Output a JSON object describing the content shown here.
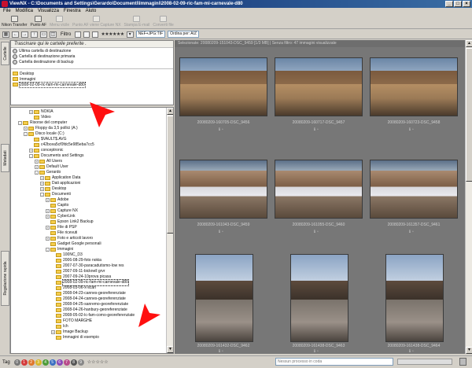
{
  "window": {
    "title": "ViewNX - C:\\Documents and Settings\\Gerardo\\Documenti\\Immagini\\2008-02-09-ric-fam-mi-carnevale-d80"
  },
  "menu": [
    "File",
    "Modifica",
    "Visualizza",
    "Finestra",
    "Aiuto"
  ],
  "toolbar1": [
    {
      "label": "Nikon Transfer",
      "enabled": true
    },
    {
      "label": "Punto AF",
      "enabled": true
    },
    {
      "label": "Menu vicile",
      "enabled": false
    },
    {
      "label": "Punto AF viene Capture NX",
      "enabled": false
    },
    {
      "label": "Stampa E-mail",
      "enabled": false
    },
    {
      "label": "Converti file",
      "enabled": false
    }
  ],
  "toolbar2": {
    "filter_label": "Filtro",
    "stars": "★★★★★★",
    "format_select": "NEF+JPG:TIF",
    "sort_select": "Ordina per: A/Z"
  },
  "sidebar_tabs": {
    "cartelle": "Cartelle",
    "metadati": "Metadati",
    "regolazione": "Regolazione rapida"
  },
  "favorites": {
    "header": "Trascinare qui le cartelle preferite .",
    "shortcuts": [
      "Ultima cartella di destinazione",
      "Cartella di destinazione primaria",
      "Cartella destinazione di backup"
    ],
    "folders": [
      "Desktop",
      "Immagini",
      "2008-02-09-ric-fam-mi-carnevale-d80"
    ]
  },
  "tree": [
    {
      "label": "NOKIA",
      "level": 3,
      "exp": "+"
    },
    {
      "label": "Video",
      "level": 3,
      "exp": ""
    },
    {
      "label": "Risorse del computer",
      "level": 1,
      "exp": "-"
    },
    {
      "label": "Floppy da 3,5 pollici (A:)",
      "level": 2,
      "exp": "+"
    },
    {
      "label": "Disco locale (C:)",
      "level": 2,
      "exp": "-"
    },
    {
      "label": "$VAULT$.AVG",
      "level": 3,
      "exp": ""
    },
    {
      "label": "c42bcea5cf0fdc5e985eba7cc5",
      "level": 3,
      "exp": ""
    },
    {
      "label": "conceptronic",
      "level": 3,
      "exp": "+"
    },
    {
      "label": "Documents and Settings",
      "level": 3,
      "exp": "-"
    },
    {
      "label": "All Users",
      "level": 4,
      "exp": "+"
    },
    {
      "label": "Default User",
      "level": 4,
      "exp": "+"
    },
    {
      "label": "Gerardo",
      "level": 4,
      "exp": "-"
    },
    {
      "label": "Application Data",
      "level": 5,
      "exp": "+"
    },
    {
      "label": "Dati applicazioni",
      "level": 5,
      "exp": "+"
    },
    {
      "label": "Desktop",
      "level": 5,
      "exp": "+"
    },
    {
      "label": "Documenti",
      "level": 5,
      "exp": "-"
    },
    {
      "label": "Adobe",
      "level": 6,
      "exp": "+"
    },
    {
      "label": "Capito",
      "level": 6,
      "exp": ""
    },
    {
      "label": "Capture NX",
      "level": 6,
      "exp": "+"
    },
    {
      "label": "CyberLink",
      "level": 6,
      "exp": "+"
    },
    {
      "label": "Epson Link2 Backup",
      "level": 6,
      "exp": ""
    },
    {
      "label": "File di PSP",
      "level": 6,
      "exp": "+"
    },
    {
      "label": "File ricevuti",
      "level": 6,
      "exp": ""
    },
    {
      "label": "Foto e articoli lavoro",
      "level": 6,
      "exp": "+"
    },
    {
      "label": "Gadget Google personali",
      "level": 6,
      "exp": ""
    },
    {
      "label": "Immagini",
      "level": 6,
      "exp": "-"
    },
    {
      "label": "100NC_D3",
      "level": 7,
      "exp": ""
    },
    {
      "label": "2006-08-29-foto nokia",
      "level": 7,
      "exp": ""
    },
    {
      "label": "2007-07-30-paracadutismo-low res",
      "level": 7,
      "exp": ""
    },
    {
      "label": "2007-09-11-bicknell grvr",
      "level": 7,
      "exp": ""
    },
    {
      "label": "2007-09-24-10prova picasa",
      "level": 7,
      "exp": ""
    },
    {
      "label": "2008-02-09-ric-fam-mi-carnevale-d80",
      "level": 7,
      "exp": "",
      "selected": true
    },
    {
      "label": "2008-03-06-x-scan",
      "level": 7,
      "exp": ""
    },
    {
      "label": "2008-04-23-cannes-georeferenziate",
      "level": 7,
      "exp": ""
    },
    {
      "label": "2008-04-24-cannes-georeferenziate",
      "level": 7,
      "exp": ""
    },
    {
      "label": "2008-04-25-sanremo-georeferenziate",
      "level": 7,
      "exp": ""
    },
    {
      "label": "2008-04-26-hanbury-georeferenziate",
      "level": 7,
      "exp": ""
    },
    {
      "label": "2008-05-02-lc-fam-como-georeferenziate",
      "level": 7,
      "exp": ""
    },
    {
      "label": "FOTO MARGHE",
      "level": 7,
      "exp": ""
    },
    {
      "label": "Ich",
      "level": 7,
      "exp": ""
    },
    {
      "label": "Image Backup",
      "level": 7,
      "exp": "+"
    },
    {
      "label": "Immagini di esempio",
      "level": 7,
      "exp": ""
    }
  ],
  "content": {
    "header": "Selezionate: 20080209-151043-DSC_9459 [1/3 MB] | Senza filtro: 47 immagini visualizzate",
    "thumbnails": [
      {
        "caption": "20080209-160705-DSC_9456",
        "scene": "scene-carnival",
        "orient": "landscape"
      },
      {
        "caption": "20080209-160717-DSC_9457",
        "scene": "scene-carnival",
        "orient": "landscape"
      },
      {
        "caption": "20080209-160723-DSC_9458",
        "scene": "scene-carnival",
        "orient": "landscape"
      },
      {
        "caption": "20080209-161043-DSC_9459",
        "scene": "scene-white",
        "orient": "landscape"
      },
      {
        "caption": "20080209-161055-DSC_9460",
        "scene": "scene-white",
        "orient": "landscape"
      },
      {
        "caption": "20080209-161357-DSC_9461",
        "scene": "scene-white",
        "orient": "landscape"
      },
      {
        "caption": "20080209-161432-DSC_9462",
        "scene": "scene-sculpt",
        "orient": "portrait"
      },
      {
        "caption": "20080209-161438-DSC_9463",
        "scene": "scene-sculpt",
        "orient": "portrait"
      },
      {
        "caption": "20080209-161438-DSC_9464",
        "scene": "scene-sculpt",
        "orient": "portrait"
      }
    ]
  },
  "statusbar": {
    "tag_label": "Tag",
    "tags": [
      {
        "n": "0",
        "color": "#777777"
      },
      {
        "n": "1",
        "color": "#d43a3a"
      },
      {
        "n": "2",
        "color": "#e0762b"
      },
      {
        "n": "3",
        "color": "#d8b62a"
      },
      {
        "n": "4",
        "color": "#4f9c3a"
      },
      {
        "n": "5",
        "color": "#3a6fc2"
      },
      {
        "n": "6",
        "color": "#8a4ab8"
      },
      {
        "n": "7",
        "color": "#b84a8a"
      },
      {
        "n": "8",
        "color": "#555555"
      },
      {
        "n": "9",
        "color": "#888888"
      }
    ],
    "stars": "☆☆☆☆☆",
    "process_text": "Nessun processo in coda"
  }
}
